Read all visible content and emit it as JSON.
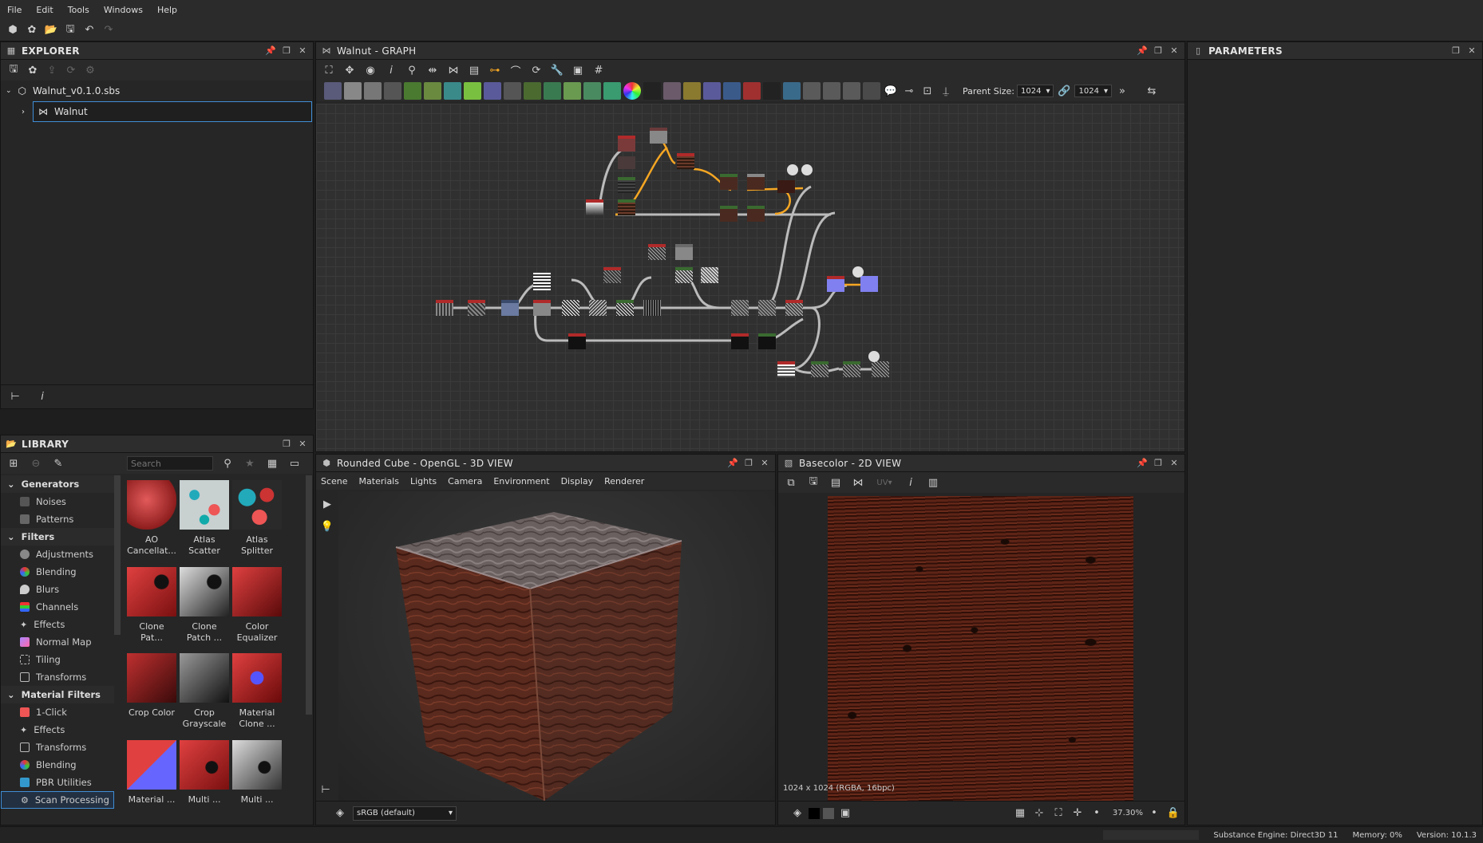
{
  "menu": [
    "File",
    "Edit",
    "Tools",
    "Windows",
    "Help"
  ],
  "explorer": {
    "title": "EXPLORER",
    "package": "Walnut_v0.1.0.sbs",
    "graph": "Walnut"
  },
  "graph": {
    "title": "Walnut - GRAPH",
    "parent_size_label": "Parent Size:",
    "size_w": "1024",
    "size_h": "1024"
  },
  "parameters": {
    "title": "PARAMETERS"
  },
  "library": {
    "title": "LIBRARY",
    "search_placeholder": "Search",
    "categories": [
      {
        "label": "Generators",
        "items": [
          "Noises",
          "Patterns"
        ]
      },
      {
        "label": "Filters",
        "items": [
          "Adjustments",
          "Blending",
          "Blurs",
          "Channels",
          "Effects",
          "Normal Map",
          "Tiling",
          "Transforms"
        ]
      },
      {
        "label": "Material Filters",
        "items": [
          "1-Click",
          "Effects",
          "Transforms",
          "Blending",
          "PBR Utilities",
          "Scan Processing"
        ]
      }
    ],
    "thumbs": [
      "AO Cancellat...",
      "Atlas Scatter",
      "Atlas Splitter",
      "Clone Pat...",
      "Clone Patch ...",
      "Color Equalizer",
      "Crop Color",
      "Crop Grayscale",
      "Material Clone ...",
      "Material ...",
      "Multi ...",
      "Multi ..."
    ]
  },
  "view3d": {
    "title": "Rounded Cube - OpenGL - 3D VIEW",
    "menu": [
      "Scene",
      "Materials",
      "Lights",
      "Camera",
      "Environment",
      "Display",
      "Renderer"
    ],
    "colorspace": "sRGB (default)"
  },
  "view2d": {
    "title": "Basecolor - 2D VIEW",
    "uv_label": "UV",
    "info": "1024 x 1024 (RGBA, 16bpc)",
    "zoom": "37.30%"
  },
  "status": {
    "engine": "Substance Engine: Direct3D 11",
    "memory": "Memory: 0%",
    "version": "Version: 10.1.3"
  },
  "colors": {
    "accent": "#3f8ed6",
    "wire_orange": "#f5a623",
    "node_red": "#b02a2a"
  }
}
